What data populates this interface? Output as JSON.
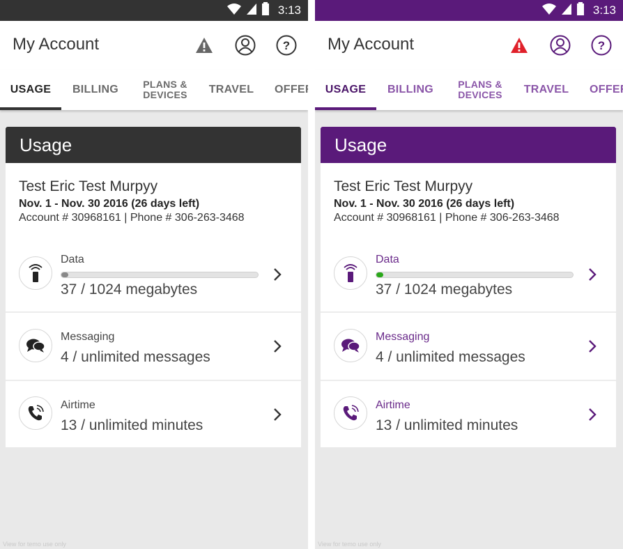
{
  "status": {
    "time": "3:13"
  },
  "appbar": {
    "title": "My Account"
  },
  "tabs": [
    {
      "label": "USAGE",
      "active": true
    },
    {
      "label": "BILLING"
    },
    {
      "label_line1": "PLANS &",
      "label_line2": "DEVICES"
    },
    {
      "label": "TRAVEL"
    },
    {
      "label": "OFFERS"
    }
  ],
  "card": {
    "title": "Usage",
    "account_name": "Test Eric Test Murpyy",
    "period": "Nov. 1 - Nov. 30 2016 (26 days left)",
    "account_line": "Account # 30968161 | Phone # 306-263-3468",
    "rows": [
      {
        "label": "Data",
        "value": "37 / 1024 megabytes",
        "progress": 0.036
      },
      {
        "label": "Messaging",
        "value": "4 / unlimited messages"
      },
      {
        "label": "Airtime",
        "value": "13 / unlimited minutes"
      }
    ]
  },
  "themes": {
    "left": {
      "primary": "#333333",
      "statusbar": "#333333",
      "tab_inactive": "#6a6a6a",
      "tab_active": "#222222",
      "warn": "#666666",
      "label": "#444444",
      "progress": "#888888",
      "icon": "#222222",
      "chevron": "#333333"
    },
    "right": {
      "primary": "#5a1a7a",
      "statusbar": "#5a1a7a",
      "tab_inactive": "#8a55a8",
      "tab_active": "#4a1468",
      "warn": "#e0202a",
      "label": "#6a2a8a",
      "progress": "#2aa81a",
      "icon": "#5a1a7a",
      "chevron": "#5a1a7a"
    }
  },
  "watermark": "View for temo use only"
}
